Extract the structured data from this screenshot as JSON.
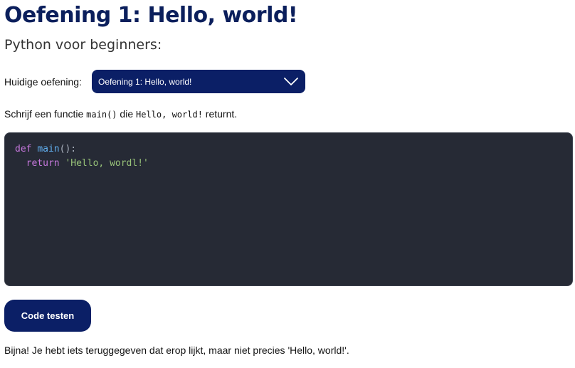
{
  "title": "Oefening 1: Hello, world!",
  "subtitle": "Python voor beginners:",
  "exercise_picker": {
    "label": "Huidige oefening:",
    "selected": "Oefening 1: Hello, world!",
    "icon": "chevron-down-icon"
  },
  "instruction": {
    "before": "Schrijf een functie ",
    "code1": "main()",
    "middle": " die ",
    "code2": "Hello, world!",
    "after": " returnt."
  },
  "editor": {
    "line1": {
      "keyword": "def",
      "name": "main",
      "rest": "():"
    },
    "line2": {
      "indent": "  ",
      "keyword": "return",
      "string": "'Hello, wordl!'"
    }
  },
  "test_button": "Code testen",
  "feedback": "Bijna! Je hebt iets teruggegeven dat erop lijkt, maar niet precies 'Hello, world!'.",
  "colors": {
    "primary": "#0b1f66",
    "title": "#0b1f5c",
    "editor_bg": "#262a35",
    "keyword": "#c678dd",
    "function": "#61afef",
    "string": "#98c379"
  }
}
